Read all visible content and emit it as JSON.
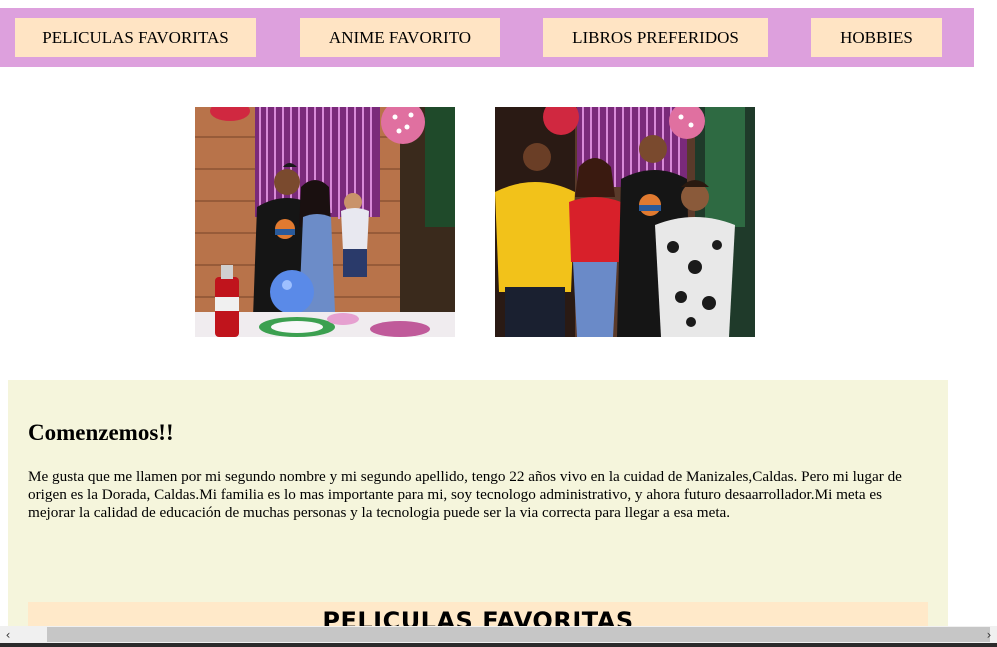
{
  "nav": {
    "items": [
      {
        "label": "PELICULAS FAVORITAS"
      },
      {
        "label": "ANIME FAVORITO"
      },
      {
        "label": "LIBROS PREFERIDOS"
      },
      {
        "label": "HOBBIES"
      }
    ],
    "colors": {
      "bar": "#dda0dd",
      "button": "#ffe4c4"
    }
  },
  "photos": [
    {
      "alt": "family-photo-1"
    },
    {
      "alt": "family-photo-2"
    }
  ],
  "intro": {
    "title": "Comenzemos!!",
    "text": "Me gusta que me llamen por mi segundo nombre y mi segundo apellido, tengo 22 años vivo en la cuidad de Manizales,Caldas. Pero mi lugar de origen es la Dorada, Caldas.Mi familia es lo mas importante para mi, soy tecnologo administrativo, y ahora futuro desaarrollador.Mi meta es mejorar la calidad de educación de muchas personas y la tecnologia puede ser la via correcta para llegar a esa meta.",
    "background": "#f5f5dc"
  },
  "section": {
    "heading": "PELICULAS FAVORITAS"
  },
  "scrollbar": {
    "left_icon": "chevron-left-icon",
    "right_icon": "chevron-right-icon"
  }
}
